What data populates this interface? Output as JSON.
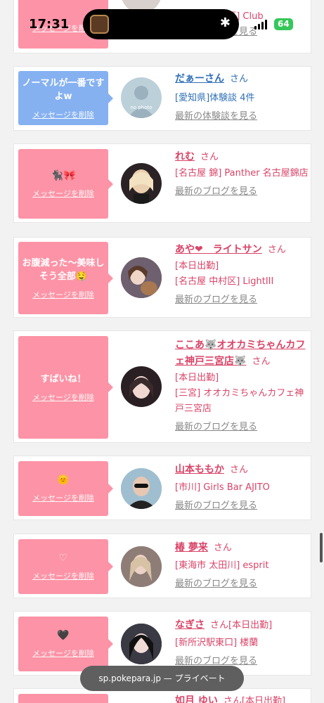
{
  "status_bar": {
    "time": "17:31",
    "battery": "64"
  },
  "top_partial": {
    "delete_label": "メッセージを削除",
    "line1": "[名古屋 中村区] Club",
    "more": "最新のブログを見る"
  },
  "cards": [
    {
      "message": "ノーマルが一番ですよw",
      "delete_label": "メッセージを削除",
      "name": "だぁーさん",
      "san": "さん",
      "lines": [
        "[愛知県]体験談 4件"
      ],
      "more": "最新の体験談を見る",
      "avatar_text": "no photo"
    },
    {
      "message": "🐈‍⬛🎀",
      "delete_label": "メッセージを削除",
      "name": "れむ",
      "san": "さん",
      "lines": [
        "[名古屋 錦] Panther 名古屋錦店"
      ],
      "more": "最新のブログを見る"
    },
    {
      "message": "お腹減った〜美味しそう全部🤤",
      "delete_label": "メッセージを削除",
      "name": "あや❤︎　ライトサン",
      "san": "さん",
      "lines": [
        "[本日出勤]",
        "[名古屋 中村区] LightIII"
      ],
      "more": "最新のブログを見る"
    },
    {
      "message": "すばいね！",
      "delete_label": "メッセージを削除",
      "name": "ここあ🐺オオカミちゃんカフェ神戸三宮店🐺",
      "san": "さん",
      "lines": [
        "[本日出勤]",
        "[三宮] オオカミちゃんカフェ神戸三宮店"
      ],
      "more": "最新のブログを見る"
    },
    {
      "message": "🌞",
      "delete_label": "メッセージを削除",
      "name": "山本ももか",
      "san": "さん",
      "lines": [
        "[市川] Girls Bar AJITO"
      ],
      "more": "最新のブログを見る"
    },
    {
      "message": "♡",
      "delete_label": "メッセージを削除",
      "name": "椿 夢来",
      "san": "さん",
      "lines": [
        "[東海市 太田川] esprit"
      ],
      "more": "最新のブログを見る"
    },
    {
      "message": "🖤",
      "delete_label": "メッセージを削除",
      "name": "なぎさ",
      "san": "さん[本日出勤]",
      "lines": [
        "[新所沢駅東口] 楼蘭"
      ],
      "more": "最新のブログを見る"
    }
  ],
  "bottom_partial": {
    "name": "如月 ゆい",
    "san": "さん[本日出勤]"
  },
  "browser": {
    "url": "sp.pokepara.jp — プライベート"
  },
  "colors": {
    "pink_bubble": "#fd93a6",
    "blue_bubble": "#86b1f1",
    "name_pink": "#d94468",
    "name_blue": "#2f6fb8"
  }
}
